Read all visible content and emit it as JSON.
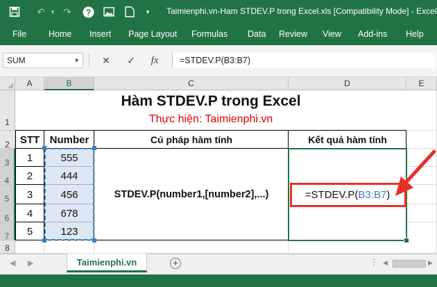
{
  "window": {
    "title": "Taimienphi.vn-Ham STDEV.P trong Excel.xls  [Compatibility Mode]  -  Excel"
  },
  "ribbon": {
    "tabs": [
      "File",
      "Home",
      "Insert",
      "Page Layout",
      "Formulas",
      "Data",
      "Review",
      "View",
      "Add-ins",
      "Help"
    ]
  },
  "formula_bar": {
    "name_box": "SUM",
    "cancel_symbol": "✕",
    "enter_symbol": "✓",
    "fx_label": "fx",
    "formula": "=STDEV.P(B3:B7)"
  },
  "columns": [
    "A",
    "B",
    "C",
    "D",
    "E"
  ],
  "rows": [
    "1",
    "2",
    "3",
    "4",
    "5",
    "6",
    "7",
    "8"
  ],
  "sheet": {
    "title": "Hàm STDEV.P trong Excel",
    "subtitle": "Thực hiện: Taimienphi.vn",
    "headers": {
      "stt": "STT",
      "number": "Number",
      "syntax": "Cú pháp hàm tính",
      "result": "Kết quả hàm tính"
    },
    "stt": [
      "1",
      "2",
      "3",
      "4",
      "5"
    ],
    "numbers": [
      "555",
      "444",
      "456",
      "678",
      "123"
    ],
    "syntax_text": "STDEV.P(number1,[number2],...)",
    "result_cell": {
      "prefix": "=STDEV.P(",
      "ref": "B3:B7",
      "suffix": ")"
    }
  },
  "sheet_tabs": {
    "active": "Taimienphi.vn",
    "add_symbol": "+"
  },
  "colors": {
    "excel_green": "#217346",
    "ref_blue": "#3c7fc0",
    "subtitle_red": "#e00000",
    "arrow_red": "#e8302a"
  }
}
